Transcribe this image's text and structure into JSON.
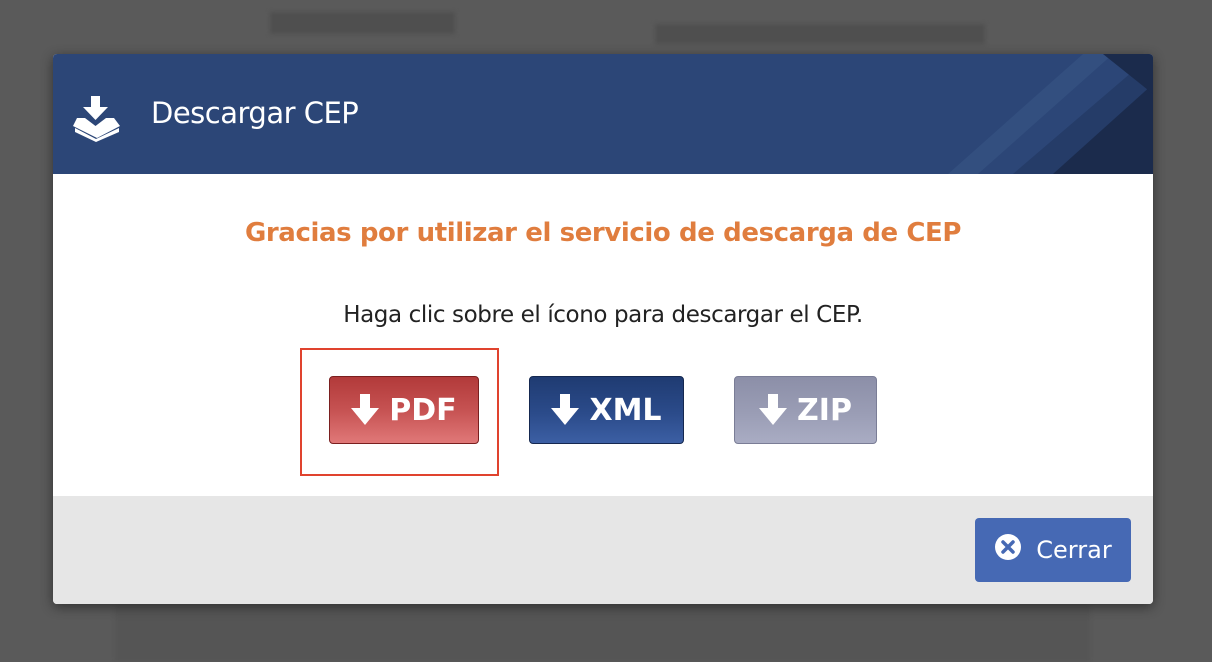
{
  "modal": {
    "title": "Descargar CEP",
    "header_icon": "download-tray-icon",
    "thanks_message": "Gracias por utilizar el servicio de descarga de CEP",
    "instruction": "Haga clic sobre el ícono para descargar el CEP.",
    "downloads": [
      {
        "label": "PDF",
        "icon": "arrow-down-icon",
        "color": "#c24d4d",
        "highlighted": true
      },
      {
        "label": "XML",
        "icon": "arrow-down-icon",
        "color": "#2b4b8a",
        "highlighted": false
      },
      {
        "label": "ZIP",
        "icon": "arrow-down-icon",
        "color": "#9a9db5",
        "highlighted": false
      }
    ],
    "close_label": "Cerrar",
    "close_icon": "times-circle-icon"
  },
  "colors": {
    "header_bg": "#2c4677",
    "accent_orange": "#e07d3e",
    "close_button": "#4669b4",
    "highlight_border": "#e0432e",
    "footer_bg": "#e6e6e6"
  }
}
